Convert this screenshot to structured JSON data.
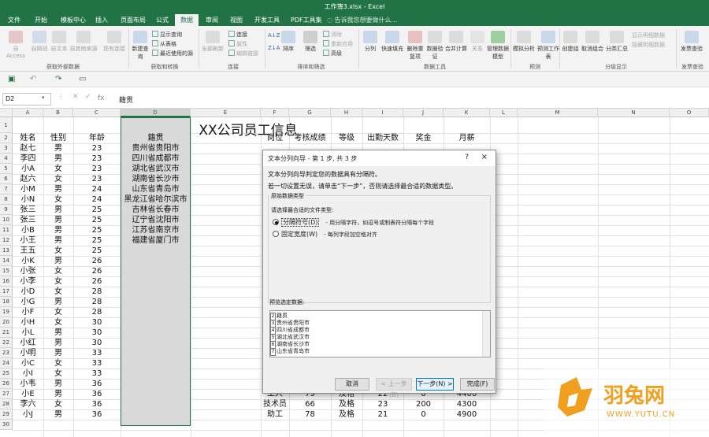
{
  "window": {
    "title": "工作簿3.xlsx - Excel"
  },
  "tabs": [
    {
      "label": "文件",
      "active": false
    },
    {
      "label": "开始",
      "active": false
    },
    {
      "label": "模板中心",
      "active": false
    },
    {
      "label": "插入",
      "active": false
    },
    {
      "label": "页面布局",
      "active": false
    },
    {
      "label": "公式",
      "active": false
    },
    {
      "label": "数据",
      "active": true
    },
    {
      "label": "审阅",
      "active": false
    },
    {
      "label": "视图",
      "active": false
    },
    {
      "label": "开发工具",
      "active": false
    },
    {
      "label": "PDF工具集",
      "active": false
    }
  ],
  "tell_me": "告诉我您想要做什么...",
  "ribbon": {
    "access": "自 Access",
    "web": "自网站",
    "text": "自文本",
    "other": "自其他来源",
    "existing": "现有连接",
    "new_query": "新建查询",
    "show_query": "显示查询",
    "from_table": "从表格",
    "recent": "最近使用的源",
    "refresh_all": "全部刷新",
    "connections": "连接",
    "properties": "属性",
    "edit_links": "编辑链接",
    "sort_az": "A↓Z",
    "sort_za": "Z↓A",
    "sort": "排序",
    "filter": "筛选",
    "clear": "清除",
    "reapply": "重新应用",
    "advanced": "高级",
    "split": "分列",
    "flash_fill": "快速填充",
    "remove_dup": "删除重复项",
    "validation": "数据验证",
    "consolidate": "合并计算",
    "relations": "关系",
    "manage_model": "管理数据模型",
    "whatif": "模拟分析",
    "forecast": "预测工作表",
    "group": "创建组",
    "ungroup": "取消组合",
    "subtotal": "分类汇总",
    "show_detail": "显示明细数据",
    "hide_detail": "隐藏明细数据",
    "invoice": "发票查验",
    "grp_external": "获取外部数据",
    "grp_transform": "获取和转换",
    "grp_conn": "连接",
    "grp_sort": "排序和筛选",
    "grp_tools": "数据工具",
    "grp_forecast": "预测",
    "grp_outline": "分级显示",
    "grp_invoice": "发票查验"
  },
  "formula_bar": {
    "name_box": "D2",
    "fx": "fx",
    "content": "籍贯"
  },
  "sheet": {
    "title": "XX公司员工信息",
    "columns": [
      "A",
      "B",
      "C",
      "D",
      "E",
      "F",
      "G",
      "H",
      "I",
      "J",
      "K",
      "L",
      "M",
      "N",
      "O"
    ],
    "headers_left": [
      "姓名",
      "性别",
      "年龄",
      "籍贯"
    ],
    "headers_right": [
      "岗位",
      "考核成绩",
      "等级",
      "出勤天数",
      "奖金",
      "月薪"
    ],
    "rows_left": [
      [
        "赵七",
        "男",
        "23",
        "贵州省贵阳市"
      ],
      [
        "李四",
        "男",
        "23",
        "四川省成都市"
      ],
      [
        "小A",
        "女",
        "23",
        "湖北省武汉市"
      ],
      [
        "赵六",
        "女",
        "23",
        "湖南省长沙市"
      ],
      [
        "小M",
        "男",
        "24",
        "山东省青岛市"
      ],
      [
        "小N",
        "女",
        "24",
        "黑龙江省哈尔滨市"
      ],
      [
        "张三",
        "男",
        "25",
        "吉林省长春市"
      ],
      [
        "张三",
        "男",
        "25",
        "辽宁省沈阳市"
      ],
      [
        "小B",
        "男",
        "25",
        "江苏省南京市"
      ],
      [
        "小王",
        "男",
        "25",
        "福建省厦门市"
      ],
      [
        "王五",
        "女",
        "25",
        ""
      ],
      [
        "小K",
        "男",
        "26",
        ""
      ],
      [
        "小张",
        "女",
        "26",
        ""
      ],
      [
        "小李",
        "女",
        "26",
        ""
      ],
      [
        "小D",
        "女",
        "28",
        ""
      ],
      [
        "小G",
        "男",
        "28",
        ""
      ],
      [
        "小F",
        "女",
        "28",
        ""
      ],
      [
        "小H",
        "女",
        "30",
        ""
      ],
      [
        "小L",
        "男",
        "30",
        ""
      ],
      [
        "小红",
        "男",
        "30",
        ""
      ],
      [
        "小明",
        "男",
        "33",
        ""
      ],
      [
        "小C",
        "女",
        "33",
        ""
      ],
      [
        "小I",
        "女",
        "33",
        ""
      ],
      [
        "小韦",
        "男",
        "36",
        ""
      ],
      [
        "小E",
        "男",
        "36",
        ""
      ],
      [
        "李六",
        "女",
        "36",
        ""
      ],
      [
        "小J",
        "男",
        "36",
        ""
      ]
    ],
    "rows_right_visible": [
      {
        "row": 27,
        "cells": [
          "工人",
          "79",
          "及格",
          "22",
          "0",
          "4400"
        ]
      },
      {
        "row": 28,
        "cells": [
          "技术员",
          "66",
          "及格",
          "23",
          "200",
          "4300"
        ]
      },
      {
        "row": 29,
        "cells": [
          "助工",
          "78",
          "及格",
          "21",
          "0",
          "4900"
        ]
      }
    ]
  },
  "dialog": {
    "title": "文本分列向导 - 第 1 步, 共 3 步",
    "help": "?",
    "close": "×",
    "line1": "文本分列向导判定您的数据具有分隔符。",
    "line2": "若一切设置无误，请单击“下一步”，否则请选择最合适的数据类型。",
    "group": "原始数据类型",
    "choose": "请选择最合适的文件类型:",
    "opt1": "分隔符号(D)",
    "opt1_desc": "- 用分隔字符，如逗号或制表符分隔每个字段",
    "opt2": "固定宽度(W)",
    "opt2_desc": "- 每列字段加空格对齐",
    "preview_label": "预览选定数据:",
    "preview_lines": [
      {
        "n": "2",
        "t": "籍贯"
      },
      {
        "n": "3",
        "t": "贵州省贵阳市"
      },
      {
        "n": "4",
        "t": "四川省成都市"
      },
      {
        "n": "5",
        "t": "湖北省武汉市"
      },
      {
        "n": "6",
        "t": "湖南省长沙市"
      },
      {
        "n": "7",
        "t": "山东省青岛市"
      }
    ],
    "cancel": "取消",
    "back": "< 上一步(B)",
    "next": "下一步(N) >",
    "finish": "完成(F)"
  },
  "watermark": {
    "text": "羽兔网",
    "url": "WWW.YUTU.CN"
  },
  "colors": {
    "excel_green": "#217346",
    "logo_orange": "#f0a01e"
  }
}
